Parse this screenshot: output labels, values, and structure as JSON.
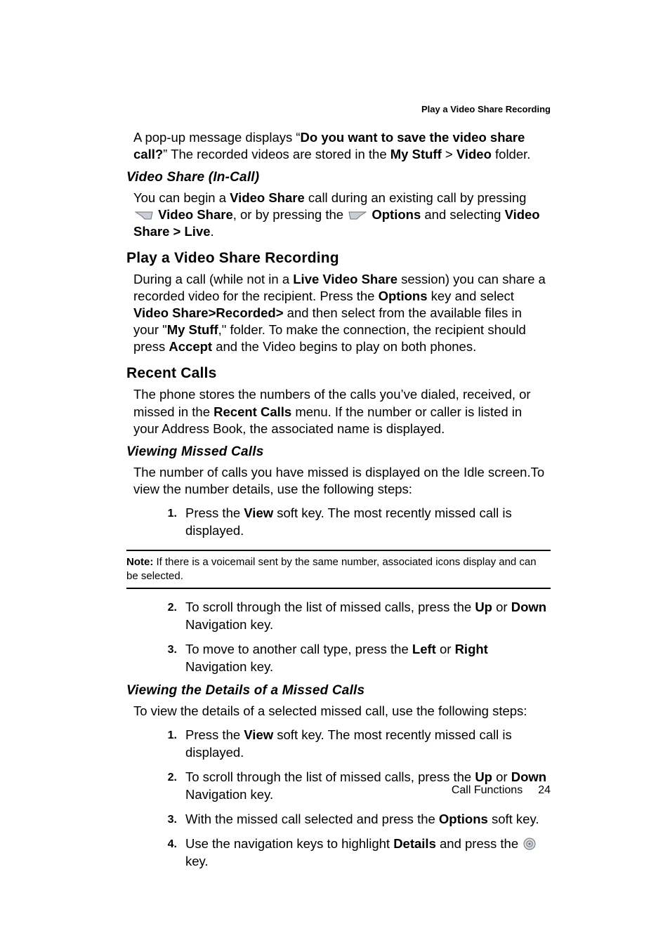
{
  "header": {
    "right": "Play a Video Share Recording"
  },
  "intro": {
    "p1_a": "A pop-up message displays “",
    "p1_b": "Do you want to save the video share call?",
    "p1_c": "” The recorded videos are stored in the ",
    "p1_d": "My Stuff",
    "p1_e": " > ",
    "p1_f": "Video",
    "p1_g": " folder."
  },
  "vs_incall": {
    "heading": "Video Share (In-Call)",
    "p_a": "You can begin a ",
    "p_b": "Video Share",
    "p_c": " call during an existing call by pressing ",
    "p_d": "Video Share",
    "p_e": ", or by pressing the ",
    "p_f": "Options",
    "p_g": " and selecting ",
    "p_h": "Video Share > Live",
    "p_i": "."
  },
  "pvsr": {
    "heading": "Play a Video Share Recording",
    "p_a": "During a call (while not in a ",
    "p_b": "Live Video Share",
    "p_c": " session) you can share a recorded video for the recipient.  Press the ",
    "p_d": "Options",
    "p_e": " key and select ",
    "p_f": "Video Share>Recorded>",
    "p_g": " and then select from the available files in your \"",
    "p_h": "My Stuff",
    "p_i": ",\" folder.  To make the connection, the recipient should press ",
    "p_j": "Accept",
    "p_k": " and the Video begins to play on both phones."
  },
  "recent": {
    "heading": "Recent Calls",
    "p_a": "The phone stores the numbers of the calls you’ve dialed, received, or missed in the ",
    "p_b": "Recent Calls",
    "p_c": " menu. If the number or caller is listed in your Address Book, the associated name is displayed."
  },
  "vmc": {
    "heading": "Viewing Missed Calls",
    "p": "The number of calls you have missed is displayed on the Idle screen.To view the number details, use the following steps:",
    "step1_num": "1.",
    "step1_a": "Press the ",
    "step1_b": "View",
    "step1_c": " soft key. The most recently missed call is displayed.",
    "note_label": "Note:",
    "note_text": " If there is a voicemail sent by the same number, associated icons display and can be selected.",
    "step2_num": "2.",
    "step2_a": "To scroll through the list of missed calls, press the ",
    "step2_b": "Up",
    "step2_c": " or ",
    "step2_d": "Down",
    "step2_e": " Navigation key.",
    "step3_num": "3.",
    "step3_a": "To move to another call type, press the ",
    "step3_b": "Left",
    "step3_c": " or ",
    "step3_d": "Right",
    "step3_e": " Navigation key."
  },
  "vdmc": {
    "heading": "Viewing the Details of a Missed Calls",
    "p": "To view the details of a selected missed call, use the following steps:",
    "step1_num": "1.",
    "step1_a": "Press the ",
    "step1_b": "View",
    "step1_c": " soft key. The most recently missed call is displayed.",
    "step2_num": "2.",
    "step2_a": "To scroll through the list of missed calls, press the ",
    "step2_b": "Up",
    "step2_c": " or ",
    "step2_d": "Down",
    "step2_e": " Navigation key.",
    "step3_num": "3.",
    "step3_a": "With the missed call selected and press the ",
    "step3_b": "Options",
    "step3_c": " soft key.",
    "step4_num": "4.",
    "step4_a": "Use the navigation keys to highlight ",
    "step4_b": "Details",
    "step4_c": " and press the ",
    "step4_d": " key."
  },
  "footer": {
    "section": "Call Functions",
    "page": "24"
  }
}
